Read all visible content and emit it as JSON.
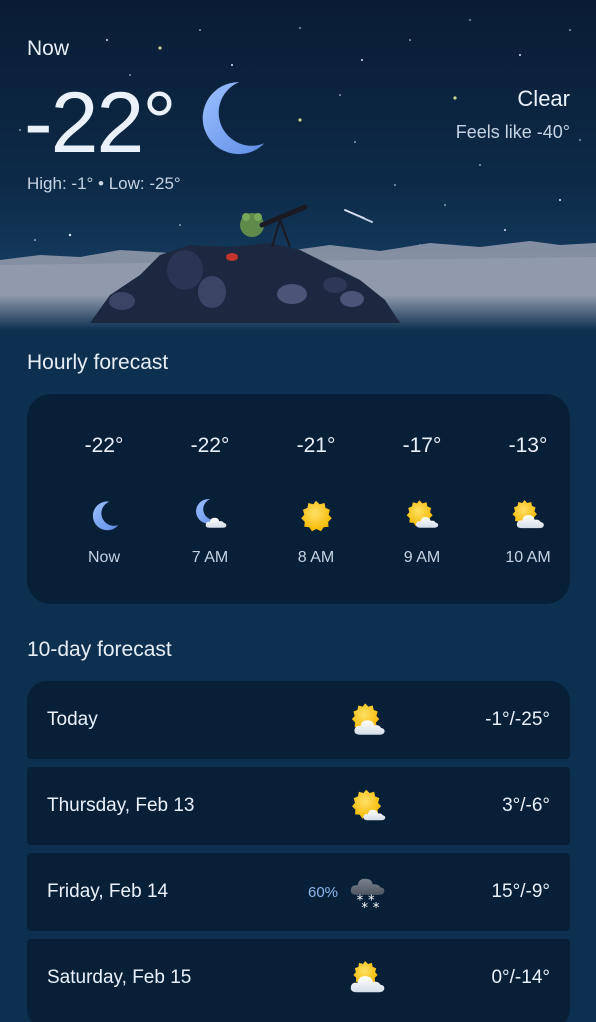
{
  "current": {
    "label": "Now",
    "temperature": "-22°",
    "high_low": "High: -1° • Low: -25°",
    "condition": "Clear",
    "feels_like": "Feels like -40°",
    "icon": "moon-icon"
  },
  "hourly": {
    "title": "Hourly forecast",
    "items": [
      {
        "temp": "-22°",
        "time": "Now",
        "icon": "moon-icon"
      },
      {
        "temp": "-22°",
        "time": "7 AM",
        "icon": "moon-cloud-icon"
      },
      {
        "temp": "-21°",
        "time": "8 AM",
        "icon": "sun-icon"
      },
      {
        "temp": "-17°",
        "time": "9 AM",
        "icon": "sun-cloud-icon"
      },
      {
        "temp": "-13°",
        "time": "10 AM",
        "icon": "sun-cloud-icon"
      }
    ]
  },
  "daily": {
    "title": "10-day forecast",
    "items": [
      {
        "day": "Today",
        "temps": "-1°/-25°",
        "icon": "sun-cloud-icon",
        "precip": ""
      },
      {
        "day": "Thursday, Feb 13",
        "temps": "3°/-6°",
        "icon": "sun-cloud-icon",
        "precip": ""
      },
      {
        "day": "Friday, Feb 14",
        "temps": "15°/-9°",
        "icon": "cloud-snow-icon",
        "precip": "60%"
      },
      {
        "day": "Saturday, Feb 15",
        "temps": "0°/-14°",
        "icon": "sun-cloud-icon",
        "precip": ""
      }
    ]
  },
  "colors": {
    "background": "#0d3050",
    "card": "#081f38",
    "moon": "#7aa6f2",
    "sun": "#f7c52c",
    "precip": "#8ab8ec"
  }
}
